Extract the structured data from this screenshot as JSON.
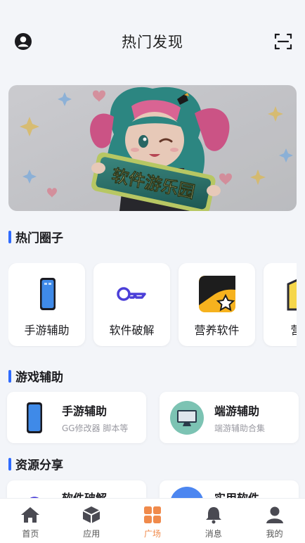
{
  "header": {
    "title": "热门发现"
  },
  "banner": {
    "sign_text": "软件游乐园"
  },
  "sections": {
    "hot_circles": {
      "title": "热门圈子"
    },
    "game_assist": {
      "title": "游戏辅助"
    },
    "resource_share": {
      "title": "资源分享"
    }
  },
  "hot_circles": [
    {
      "label": "手游辅助",
      "icon": "phone-icon"
    },
    {
      "label": "软件破解",
      "icon": "key-icon"
    },
    {
      "label": "营养软件",
      "icon": "star-box-icon"
    },
    {
      "label": "营养",
      "icon": "smile-box-icon"
    }
  ],
  "game_assist": [
    {
      "name": "手游辅助",
      "sub": "GG修改器 脚本等",
      "icon": "phone-icon"
    },
    {
      "name": "端游辅助",
      "sub": "端游辅助合集",
      "icon": "monitor-icon"
    }
  ],
  "resource_share": [
    {
      "name": "软件破解",
      "icon": "key-icon"
    },
    {
      "name": "实用软件",
      "icon": "app-icon"
    }
  ],
  "tabbar": [
    {
      "label": "首页",
      "icon": "home-icon"
    },
    {
      "label": "应用",
      "icon": "cube-icon"
    },
    {
      "label": "广场",
      "icon": "grid-icon",
      "active": true
    },
    {
      "label": "消息",
      "icon": "bell-icon"
    },
    {
      "label": "我的",
      "icon": "user-icon"
    }
  ],
  "colors": {
    "accent": "#2f6bff",
    "active_tab": "#f08a4b",
    "background": "#f3f5f9"
  }
}
